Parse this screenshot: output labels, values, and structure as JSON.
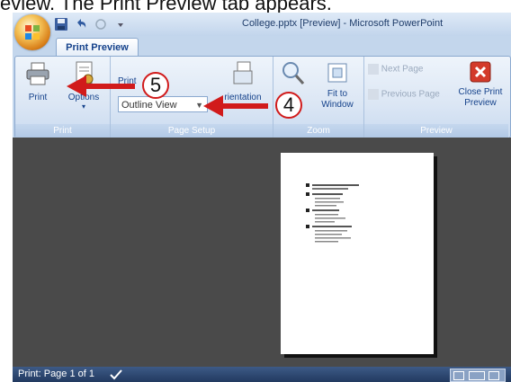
{
  "caption": "eview. The Print Preview tab appears.",
  "window": {
    "title": "College.pptx [Preview] - Microsoft PowerPoint"
  },
  "tabs": {
    "active_label": "Print Preview"
  },
  "ribbon": {
    "print_label": "Print",
    "options_label": "Options",
    "print_what_label": "Print",
    "outline_view_value": "Outline View",
    "orientation_label": "rientation",
    "zoom_label": "Zoom",
    "fit_to_window_label": "Fit to Window",
    "next_page_label": "Next Page",
    "previous_page_label": "Previous Page",
    "close_print_preview_label": "Close Print Preview",
    "groups": {
      "print": "Print",
      "page_setup": "Page Setup",
      "zoom": "Zoom",
      "preview": "Preview"
    }
  },
  "status": {
    "page_text": "Print: Page 1 of 1"
  },
  "callouts": {
    "step4": "4",
    "step5": "5"
  },
  "colors": {
    "callout_red": "#d11b1b",
    "close_red": "#d33a2a",
    "ribbon_text": "#15428b"
  }
}
